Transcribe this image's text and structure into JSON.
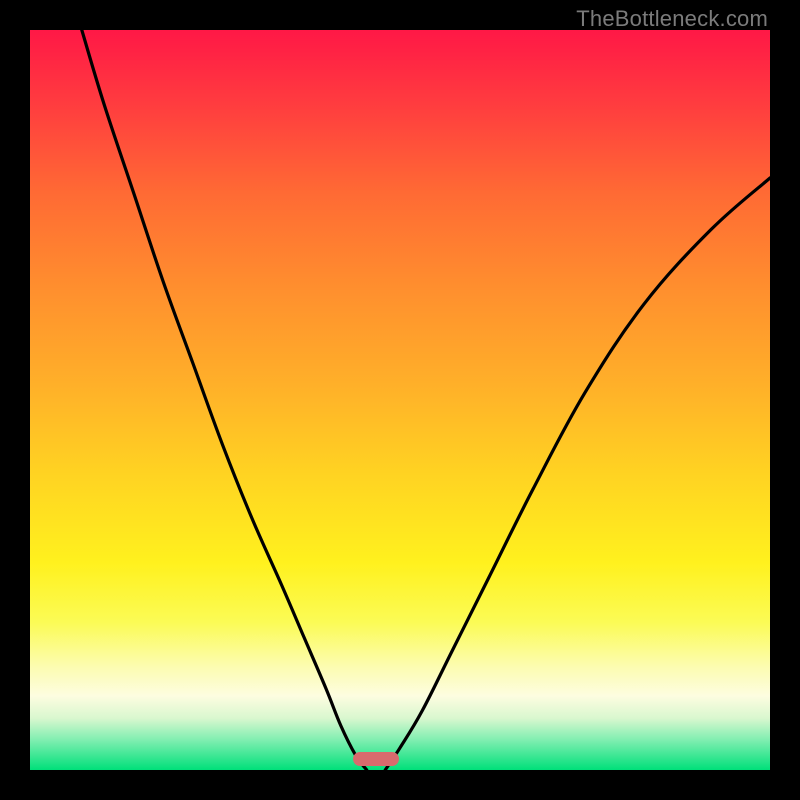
{
  "watermark": "TheBottleneck.com",
  "colors": {
    "frame": "#000000",
    "watermark": "#7b7b7b",
    "curve": "#000000",
    "marker": "#d86a6d",
    "green": "#00e07a"
  },
  "gradient_stops": [
    {
      "pct": 0,
      "color": "#ff1846"
    },
    {
      "pct": 10,
      "color": "#ff3c3f"
    },
    {
      "pct": 22,
      "color": "#ff6a34"
    },
    {
      "pct": 35,
      "color": "#ff8f2e"
    },
    {
      "pct": 48,
      "color": "#ffb029"
    },
    {
      "pct": 60,
      "color": "#ffd322"
    },
    {
      "pct": 72,
      "color": "#fff11e"
    },
    {
      "pct": 80,
      "color": "#fbfb55"
    },
    {
      "pct": 86,
      "color": "#fcfcb0"
    },
    {
      "pct": 90,
      "color": "#fdfde0"
    },
    {
      "pct": 93,
      "color": "#d9f7cf"
    },
    {
      "pct": 96,
      "color": "#7eeeb0"
    },
    {
      "pct": 100,
      "color": "#00e07a"
    }
  ],
  "chart_data": {
    "type": "line",
    "title": "",
    "xlabel": "",
    "ylabel": "",
    "xlim": [
      0,
      100
    ],
    "ylim": [
      0,
      100
    ],
    "notes": "Two monotone curves descending to a common minimum near x≈45 at y≈0; values are percentage of plot height (100=top).",
    "series": [
      {
        "name": "left-curve",
        "x": [
          7,
          10,
          14,
          18,
          22,
          26,
          30,
          34,
          37,
          40,
          42,
          44,
          45.5
        ],
        "y": [
          100,
          90,
          78,
          66,
          55,
          44,
          34,
          25,
          18,
          11,
          6,
          2,
          0
        ]
      },
      {
        "name": "right-curve",
        "x": [
          48,
          50,
          53,
          57,
          62,
          68,
          75,
          83,
          92,
          100
        ],
        "y": [
          0,
          3,
          8,
          16,
          26,
          38,
          51,
          63,
          73,
          80
        ]
      }
    ],
    "marker": {
      "x_center": 46.8,
      "width_pct": 6.2,
      "y": 0
    }
  }
}
